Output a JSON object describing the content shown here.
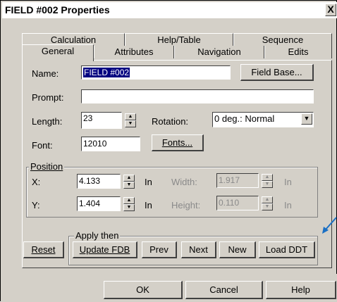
{
  "window": {
    "title": "FIELD #002 Properties",
    "close_label": "X"
  },
  "tabs_row1": [
    "Calculation",
    "Help/Table",
    "Sequence"
  ],
  "tabs_row2": [
    "General",
    "Attributes",
    "Navigation",
    "Edits"
  ],
  "active_tab": "General",
  "general": {
    "name_label": "Name:",
    "name_value": "FIELD #002",
    "field_base_label": "Field Base...",
    "prompt_label": "Prompt:",
    "prompt_value": "",
    "length_label": "Length:",
    "length_value": "23",
    "rotation_label": "Rotation:",
    "rotation_value": "0 deg.: Normal",
    "font_label": "Font:",
    "font_value": "12010",
    "fonts_button": "Fonts..."
  },
  "position": {
    "group_label": "Position",
    "x_label": "X:",
    "x_value": "4.133",
    "x_unit": "In",
    "y_label": "Y:",
    "y_value": "1.404",
    "y_unit": "In",
    "width_label": "Width:",
    "width_value": "1.917",
    "width_unit": "In",
    "height_label": "Height:",
    "height_value": "0.110",
    "height_unit": "In"
  },
  "apply": {
    "group_label": "Apply then",
    "reset": "Reset",
    "update_fdb": "Update FDB",
    "prev": "Prev",
    "next": "Next",
    "new": "New",
    "load_ddt": "Load DDT"
  },
  "footer": {
    "ok": "OK",
    "cancel": "Cancel",
    "help": "Help"
  },
  "colors": {
    "title_bg": "#ffffff",
    "face": "#d4d0c8",
    "selection": "#000080",
    "arrow": "#1a6fc4"
  }
}
